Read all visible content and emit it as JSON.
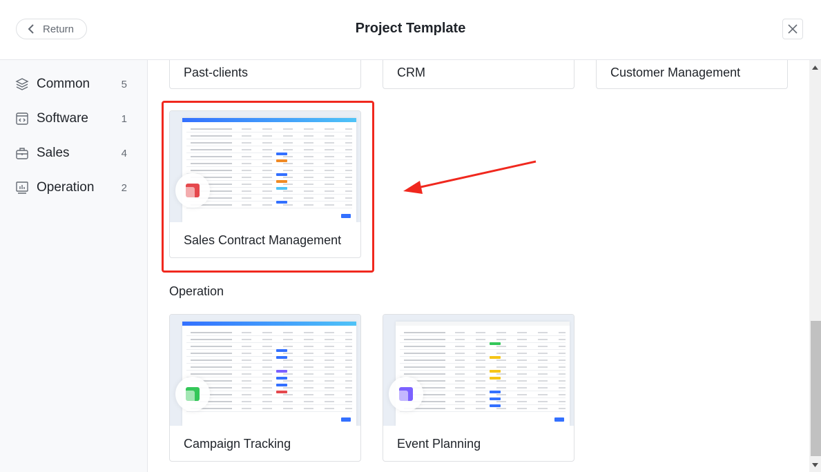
{
  "header": {
    "return_label": "Return",
    "title": "Project Template"
  },
  "sidebar": {
    "items": [
      {
        "label": "Common",
        "count": "5",
        "icon": "layers-icon"
      },
      {
        "label": "Software",
        "count": "1",
        "icon": "code-window-icon"
      },
      {
        "label": "Sales",
        "count": "4",
        "icon": "briefcase-icon"
      },
      {
        "label": "Operation",
        "count": "2",
        "icon": "bar-chart-icon"
      }
    ]
  },
  "templates_top": [
    "Past-clients",
    "CRM",
    "Customer Management"
  ],
  "sales_template": {
    "name": "Sales Contract Management",
    "accent": "#e5484d"
  },
  "operation": {
    "heading": "Operation",
    "templates": [
      {
        "name": "Campaign Tracking",
        "accent": "#34c759"
      },
      {
        "name": "Event Planning",
        "accent": "#7b61ff"
      }
    ]
  },
  "annotation": {
    "highlight_color": "#f0281e"
  }
}
